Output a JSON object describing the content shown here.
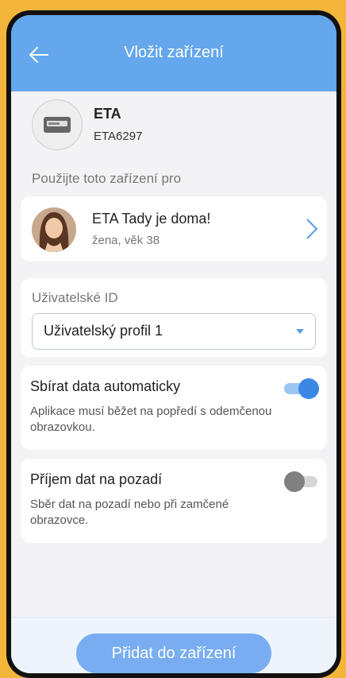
{
  "header": {
    "title": "Vložit zařízení",
    "back_icon": "arrow-left-icon"
  },
  "device": {
    "name": "ETA",
    "id": "ETA6297",
    "icon": "scale-device-icon"
  },
  "usage": {
    "label": "Použijte toto zařízení pro",
    "user": {
      "name": "ETA Tady je doma!",
      "meta": "žena, věk 38"
    }
  },
  "user_id": {
    "label": "Uživatelské ID",
    "selected": "Uživatelský profil 1"
  },
  "options": {
    "auto": {
      "title": "Sbírat data automaticky",
      "desc": "Aplikace musí běžet na popředí s odemčenou obrazovkou.",
      "enabled": true
    },
    "background": {
      "title": "Příjem dat na pozadí",
      "desc": "Sběr dat na pozadí nebo při zamčené obrazovce.",
      "enabled": false
    }
  },
  "footer": {
    "add_label": "Přidat do zařízení"
  },
  "colors": {
    "primary": "#64a7ec",
    "accent": "#3a88e4",
    "background": "#f3f3f5",
    "frame": "#f4b63a"
  }
}
